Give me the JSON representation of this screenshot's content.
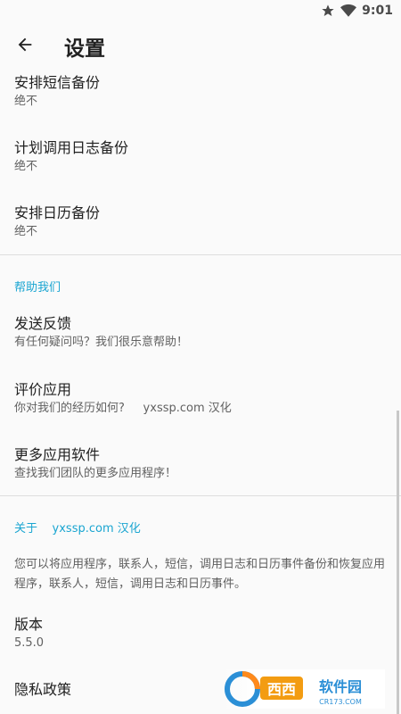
{
  "status": {
    "time": "9:01"
  },
  "header": {
    "title": "设置"
  },
  "items_top": [
    {
      "title": "安排短信备份",
      "subtitle": "绝不"
    },
    {
      "title": "计划调用日志备份",
      "subtitle": "绝不"
    },
    {
      "title": "安排日历备份",
      "subtitle": "绝不"
    }
  ],
  "help": {
    "header": "帮助我们",
    "items": [
      {
        "title": "发送反馈",
        "subtitle": "有任何疑问吗？我们很乐意帮助！"
      },
      {
        "title": "评价应用",
        "subtitle": "你对我们的经历如何?     yxssp.com 汉化"
      },
      {
        "title": "更多应用软件",
        "subtitle": "查找我们团队的更多应用程序！"
      }
    ]
  },
  "about": {
    "header": "关于    yxssp.com 汉化",
    "description": "您可以将应用程序，联系人，短信，调用日志和日历事件备份和恢复应用程序，联系人，短信，调用日志和日历事件。",
    "version_title": "版本",
    "version_value": "5.5.0",
    "privacy_title": "隐私政策"
  },
  "watermark": {
    "brand": "西西软件园",
    "site": "CR173.COM"
  },
  "colors": {
    "accent": "#1aa5d1",
    "background": "#fafafa"
  }
}
